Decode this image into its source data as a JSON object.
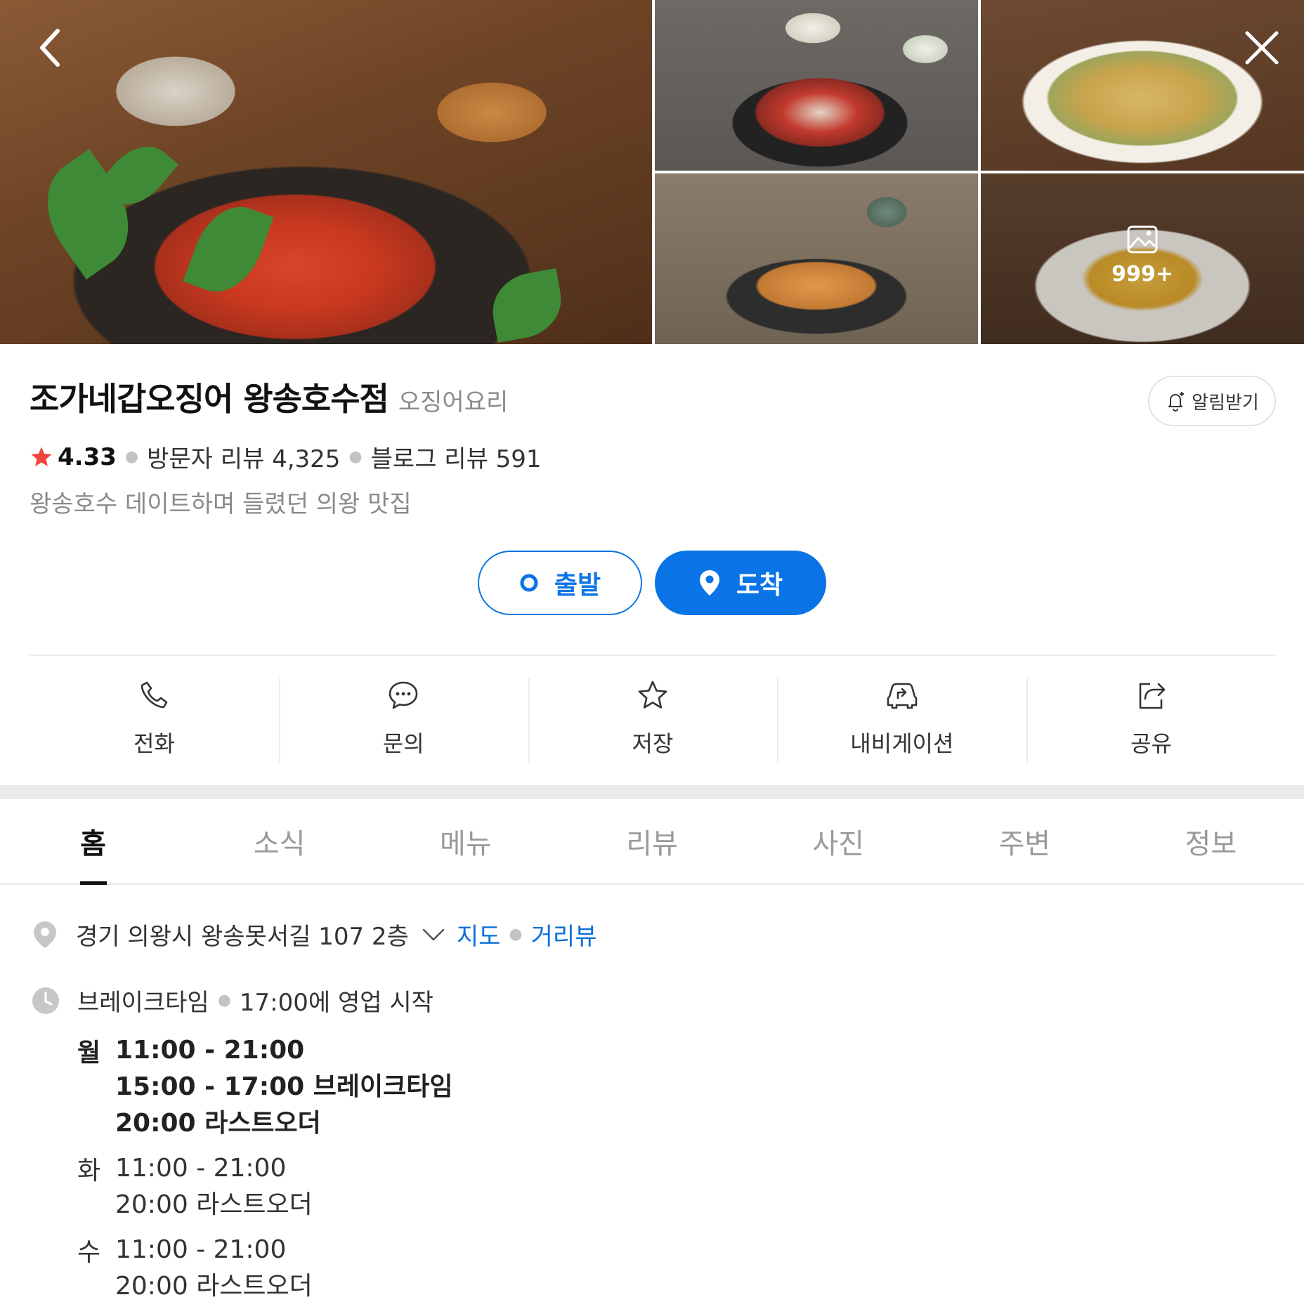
{
  "photos": {
    "count_label": "999+"
  },
  "place": {
    "name": "조가네갑오징어 왕송호수점",
    "category": "오징어요리",
    "alarm_label": "알림받기",
    "rating": "4.33",
    "visitor_reviews": "방문자 리뷰 4,325",
    "blog_reviews": "블로그 리뷰 591",
    "description": "왕송호수 데이트하며 들렸던 의왕 맛집"
  },
  "route": {
    "depart_label": "출발",
    "arrive_label": "도착"
  },
  "actions": [
    {
      "label": "전화",
      "icon": "phone-icon"
    },
    {
      "label": "문의",
      "icon": "chat-bubble-icon"
    },
    {
      "label": "저장",
      "icon": "star-icon"
    },
    {
      "label": "내비게이션",
      "icon": "car-navigation-icon"
    },
    {
      "label": "공유",
      "icon": "share-icon"
    }
  ],
  "tabs": [
    {
      "label": "홈",
      "active": true
    },
    {
      "label": "소식"
    },
    {
      "label": "메뉴"
    },
    {
      "label": "리뷰"
    },
    {
      "label": "사진"
    },
    {
      "label": "주변"
    },
    {
      "label": "정보"
    }
  ],
  "details": {
    "address": "경기 의왕시 왕송못서길 107 2층",
    "map_link": "지도",
    "street_view_link": "거리뷰",
    "hours_label": "브레이크타임",
    "hours_status": "17:00에 영업 시작",
    "schedule": [
      {
        "day": "월",
        "lines": [
          "11:00 - 21:00",
          "15:00 - 17:00 브레이크타임",
          "20:00 라스트오더"
        ]
      },
      {
        "day": "화",
        "lines": [
          "11:00 - 21:00",
          "20:00 라스트오더"
        ]
      },
      {
        "day": "수",
        "lines": [
          "11:00 - 21:00",
          "20:00 라스트오더"
        ]
      }
    ]
  },
  "colors": {
    "accent": "#0a74e6",
    "link": "#0a6fd8",
    "rating_star": "#f2453d",
    "muted_text": "#8a8a8a"
  }
}
